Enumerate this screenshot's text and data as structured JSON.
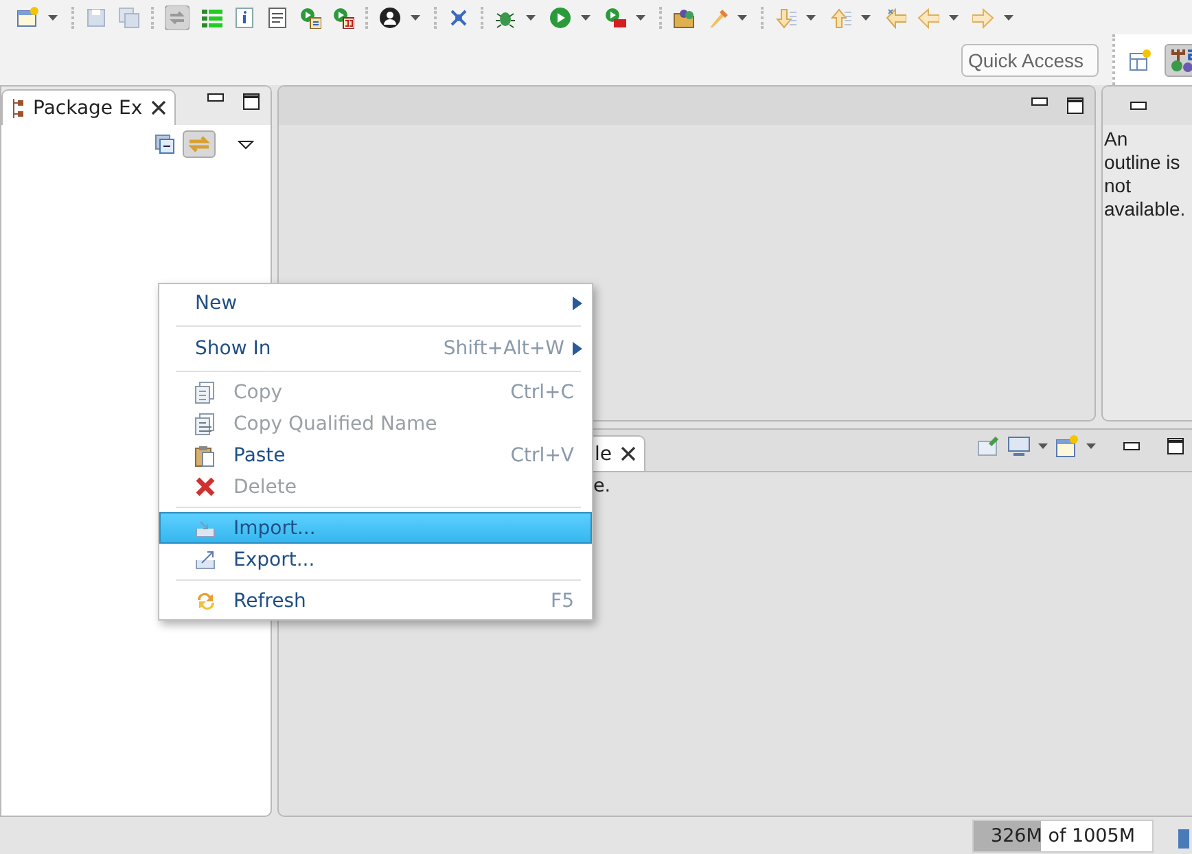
{
  "toolbar": {
    "quick_access": {
      "placeholder": "Quick Access"
    }
  },
  "package_explorer": {
    "tab": {
      "label": "Package Ex",
      "selected": true
    }
  },
  "outline": {
    "message": "An outline is not available."
  },
  "console": {
    "tab": {
      "label": "le",
      "selected": true
    },
    "message": "e."
  },
  "context_menu": {
    "items": [
      {
        "kind": "item",
        "label": "New",
        "submenu": true,
        "disabled": false,
        "selected": false
      },
      {
        "kind": "separator"
      },
      {
        "kind": "item",
        "label": "Show In",
        "shortcut": "Shift+Alt+W",
        "submenu": true,
        "disabled": false,
        "selected": false
      },
      {
        "kind": "separator"
      },
      {
        "kind": "item",
        "label": "Copy",
        "shortcut": "Ctrl+C",
        "disabled": true,
        "selected": false
      },
      {
        "kind": "item",
        "label": "Copy Qualified Name",
        "disabled": true,
        "selected": false
      },
      {
        "kind": "item",
        "label": "Paste",
        "shortcut": "Ctrl+V",
        "disabled": false,
        "selected": false
      },
      {
        "kind": "item",
        "label": "Delete",
        "disabled": true,
        "selected": false
      },
      {
        "kind": "separator"
      },
      {
        "kind": "item",
        "label": "Import...",
        "disabled": false,
        "selected": true
      },
      {
        "kind": "item",
        "label": "Export...",
        "disabled": false,
        "selected": false
      },
      {
        "kind": "separator"
      },
      {
        "kind": "item",
        "label": "Refresh",
        "shortcut": "F5",
        "disabled": false,
        "selected": false
      }
    ]
  },
  "status_bar": {
    "memory": {
      "text": "326M of 1005M",
      "level": 0.38
    }
  }
}
